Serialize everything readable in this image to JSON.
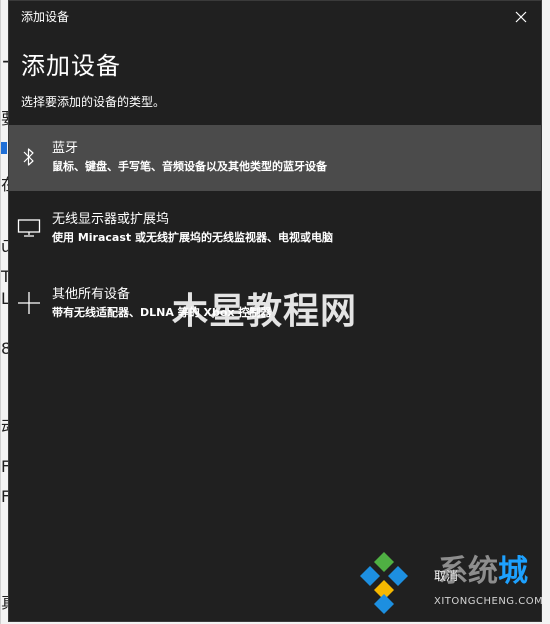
{
  "background": {
    "fragments": [
      "+",
      "要",
      "在",
      "ū",
      "T",
      "L",
      "8",
      "动",
      "F",
      "F",
      "真"
    ]
  },
  "dialog": {
    "title": "添加设备",
    "heading": "添加设备",
    "subheading": "选择要添加的设备的类型。",
    "options": [
      {
        "icon": "bluetooth-icon",
        "title": "蓝牙",
        "description": "鼠标、键盘、手写笔、音频设备以及其他类型的蓝牙设备",
        "selected": true
      },
      {
        "icon": "monitor-icon",
        "title": "无线显示器或扩展坞",
        "description": "使用 Miracast 或无线扩展坞的无线监视器、电视或电脑",
        "selected": false
      },
      {
        "icon": "plus-icon",
        "title": "其他所有设备",
        "description": "带有无线适配器、DLNA 等的 Xbox 控制器",
        "selected": false
      }
    ],
    "cancel_label": "取消"
  },
  "watermarks": {
    "center_text": "木星教程网",
    "corner_text_a": "系统",
    "corner_text_b": "城",
    "corner_url": "XITONGCHENG.COM"
  },
  "colors": {
    "dialog_bg": "#202020",
    "selected_bg": "#4b4b4b",
    "text": "#ffffff"
  }
}
